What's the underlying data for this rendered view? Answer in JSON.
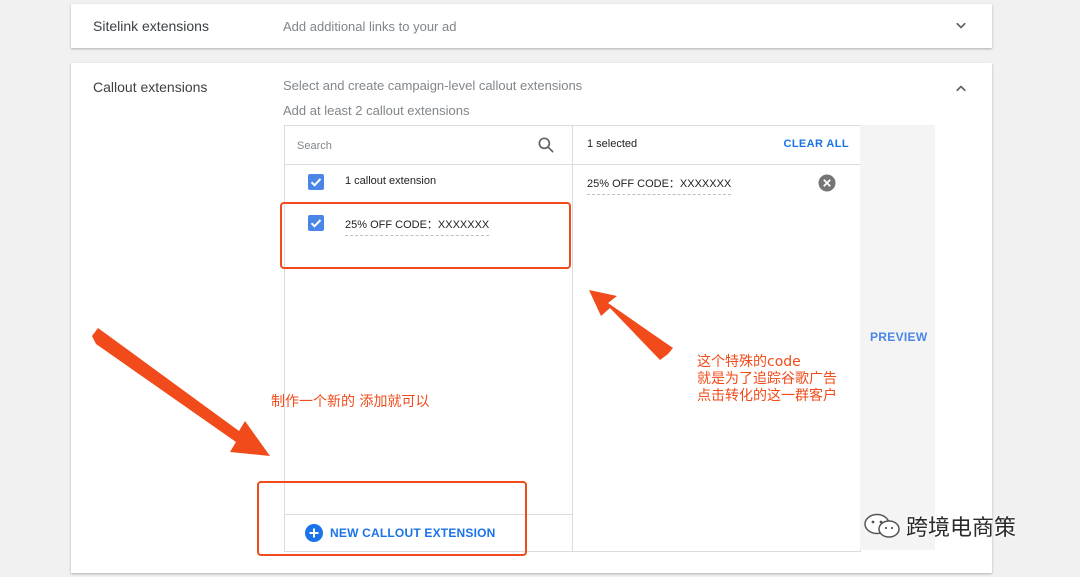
{
  "sitelink": {
    "title": "Sitelink extensions",
    "description": "Add additional links to your ad"
  },
  "callout": {
    "title": "Callout extensions",
    "description_line1": "Select and create campaign-level callout extensions",
    "description_line2": "Add at least 2 callout extensions",
    "search": {
      "placeholder": "Search"
    },
    "list": [
      {
        "label": "1 callout extension",
        "checked": true
      },
      {
        "label": "25% OFF CODE：XXXXXXX",
        "checked": true
      }
    ],
    "selected": {
      "count_label": "1 selected",
      "clear_all_label": "CLEAR ALL",
      "items": [
        "25% OFF CODE：XXXXXXX"
      ]
    },
    "new_button_label": "NEW CALLOUT EXTENSION",
    "preview_label": "PREVIEW"
  },
  "annotations": {
    "left_note": "制作一个新的 添加就可以",
    "right_note_line1": "这个特殊的code",
    "right_note_line2": "就是为了追踪谷歌广告",
    "right_note_line3": "点击转化的这一群客户"
  },
  "watermark": {
    "text": "跨境电商策"
  },
  "colors": {
    "accent_blue": "#1a73e8",
    "checkbox_blue": "#4a86e8",
    "annotation_red": "#f24b1b",
    "page_background": "#f1f1f1"
  },
  "icons": [
    "chevron-down-icon",
    "chevron-up-icon",
    "search-icon",
    "checkbox-checked-icon",
    "remove-circle-icon",
    "add-circle-icon",
    "wechat-icon"
  ]
}
